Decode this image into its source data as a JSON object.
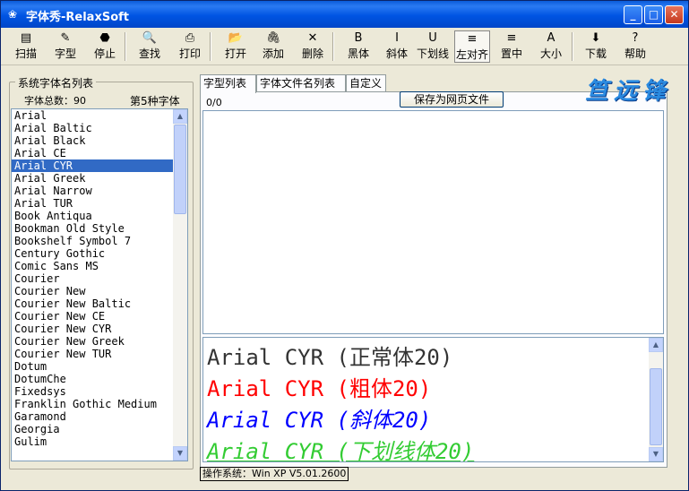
{
  "window": {
    "title": "字体秀-RelaxSoft",
    "min_label": "_",
    "max_label": "□",
    "close_label": "✕"
  },
  "toolbar": [
    {
      "label": "扫描",
      "icon": "printer-scan-icon",
      "glyph": "▤"
    },
    {
      "label": "字型",
      "icon": "font-style-icon",
      "glyph": "✎"
    },
    {
      "label": "停止",
      "icon": "stop-icon",
      "glyph": "⬣"
    },
    {
      "label": "查找",
      "icon": "find-icon",
      "glyph": "🔍"
    },
    {
      "label": "打印",
      "icon": "print-icon",
      "glyph": "⎙"
    },
    {
      "label": "打开",
      "icon": "open-folder-icon",
      "glyph": "📂"
    },
    {
      "label": "添加",
      "icon": "paperclip-icon",
      "glyph": "🖇"
    },
    {
      "label": "删除",
      "icon": "delete-x-icon",
      "glyph": "✕"
    },
    {
      "label": "黑体",
      "icon": "bold-icon",
      "glyph": "B"
    },
    {
      "label": "斜体",
      "icon": "italic-icon",
      "glyph": "I"
    },
    {
      "label": "下划线",
      "icon": "underline-icon",
      "glyph": "U"
    },
    {
      "label": "左对齐",
      "icon": "align-left-icon",
      "glyph": "≡"
    },
    {
      "label": "置中",
      "icon": "align-center-icon",
      "glyph": "≡"
    },
    {
      "label": "大小",
      "icon": "font-size-icon",
      "glyph": "A"
    },
    {
      "label": "下载",
      "icon": "download-icon",
      "glyph": "⬇"
    },
    {
      "label": "帮助",
      "icon": "help-icon",
      "glyph": "?"
    }
  ],
  "left": {
    "group_title": "系统字体名列表",
    "count_label": "字体总数：90",
    "nth_label": "第5种字体",
    "fonts": [
      "Arial",
      "Arial Baltic",
      "Arial Black",
      "Arial CE",
      "Arial CYR",
      "Arial Greek",
      "Arial Narrow",
      "Arial TUR",
      "Book Antiqua",
      "Bookman Old Style",
      "Bookshelf Symbol 7",
      "Century Gothic",
      "Comic Sans MS",
      "Courier",
      "Courier New",
      "Courier New Baltic",
      "Courier New CE",
      "Courier New CYR",
      "Courier New Greek",
      "Courier New TUR",
      "Dotum",
      "DotumChe",
      "Fixedsys",
      "Franklin Gothic Medium",
      "Garamond",
      "Georgia",
      "Gulim"
    ],
    "selected": "Arial CYR"
  },
  "tabs": [
    "字型列表",
    "字体文件名列表",
    "自定义"
  ],
  "panel": {
    "ratio": "0/0",
    "save_button": "保存为网页文件",
    "logo": "笪远锋"
  },
  "samples": [
    {
      "text": "Arial CYR (正常体20)",
      "color": "#333333",
      "style": "normal"
    },
    {
      "text": "Arial CYR (粗体20)",
      "color": "#ff0000",
      "style": "bold"
    },
    {
      "text": "Arial CYR (斜体20)",
      "color": "#0000ff",
      "style": "italic"
    },
    {
      "text": "Arial CYR (下划线体20)",
      "color": "#33cc33",
      "style": "underline-italic"
    }
  ],
  "status": "操作系统：Win XP V5.01.2600",
  "colors": {
    "selection": "#316ac5",
    "titlebar": "#0054e3"
  }
}
